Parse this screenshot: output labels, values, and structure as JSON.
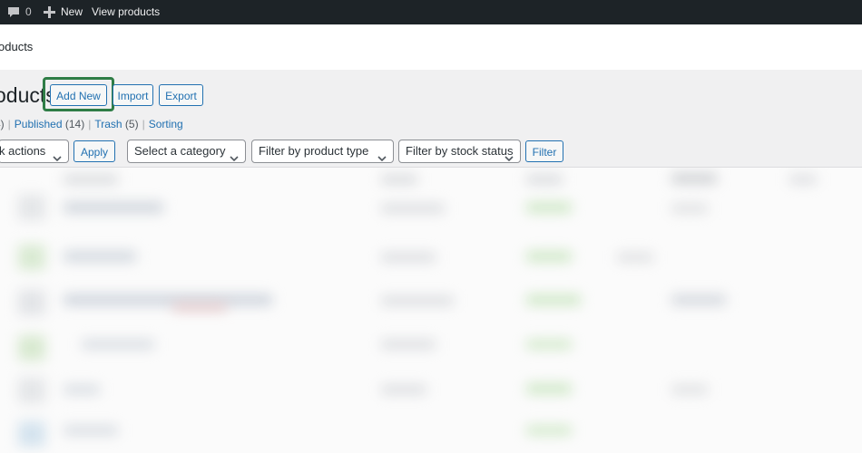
{
  "adminbar": {
    "comments_count": "0",
    "new_label": "New",
    "view_label": "View products"
  },
  "breadcrumb": "oducts",
  "page": {
    "title": "oducts",
    "add_new_label": "Add New",
    "import_label": "Import",
    "export_label": "Export"
  },
  "views": {
    "all_count_fragment": "4)",
    "published_label": "Published",
    "published_count": "(14)",
    "trash_label": "Trash",
    "trash_count": "(5)",
    "sorting_label": "Sorting"
  },
  "filters": {
    "bulk_actions": "k actions",
    "apply_label": "Apply",
    "category": "Select a category",
    "product_type": "Filter by product type",
    "stock_status": "Filter by stock status",
    "filter_label": "Filter"
  },
  "colors": {
    "admin_bar": "#1d2327",
    "link": "#2271b1",
    "highlight": "#2f7d46",
    "background": "#f0f0f1"
  }
}
